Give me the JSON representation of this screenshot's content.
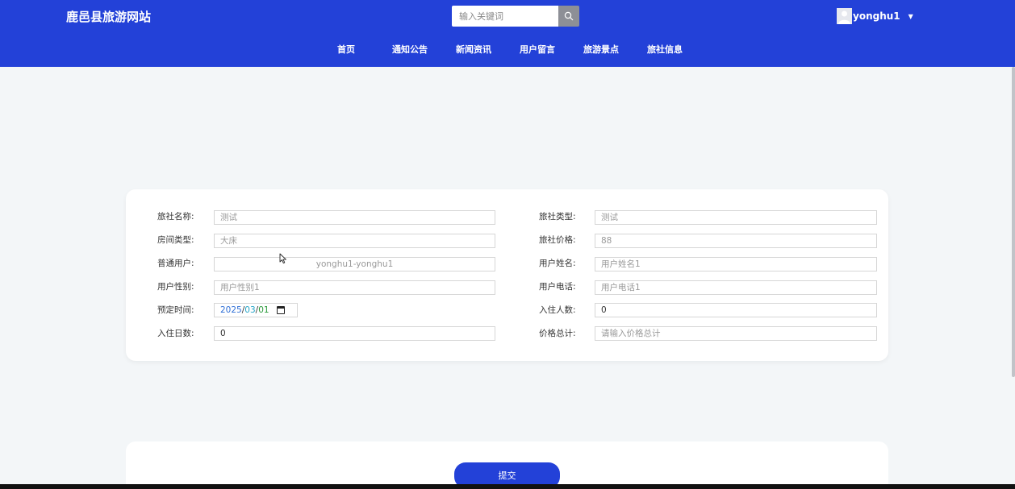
{
  "header": {
    "site_title": "鹿邑县旅游网站",
    "search": {
      "placeholder": "输入关键词",
      "value": ""
    },
    "user": {
      "name": "yonghu1",
      "avatar_icon": "avatar-icon",
      "menu_icon": "caret-down-icon"
    },
    "nav": [
      "首页",
      "通知公告",
      "新闻资讯",
      "用户留言",
      "旅游景点",
      "旅社信息"
    ],
    "colors": {
      "primary": "#2341d8"
    }
  },
  "form": {
    "left": [
      {
        "label": "旅社名称:",
        "value": "测试"
      },
      {
        "label": "房间类型:",
        "value": "大床"
      },
      {
        "label": "普通用户:",
        "value": "yonghu1-yonghu1"
      },
      {
        "label": "用户性别:",
        "value": "用户性别1"
      },
      {
        "label": "预定时间:",
        "date": {
          "year": "2025",
          "month": "03",
          "day": "01"
        }
      },
      {
        "label": "入住日数:",
        "value": "0"
      }
    ],
    "right": [
      {
        "label": "旅社类型:",
        "value": "测试"
      },
      {
        "label": "旅社价格:",
        "value": "88"
      },
      {
        "label": "用户姓名:",
        "value": "用户姓名1"
      },
      {
        "label": "用户电话:",
        "value": "用户电话1"
      },
      {
        "label": "入住人数:",
        "value": "0"
      },
      {
        "label": "价格总计:",
        "placeholder": "请输入价格总计"
      }
    ]
  },
  "submit_label": "提交"
}
